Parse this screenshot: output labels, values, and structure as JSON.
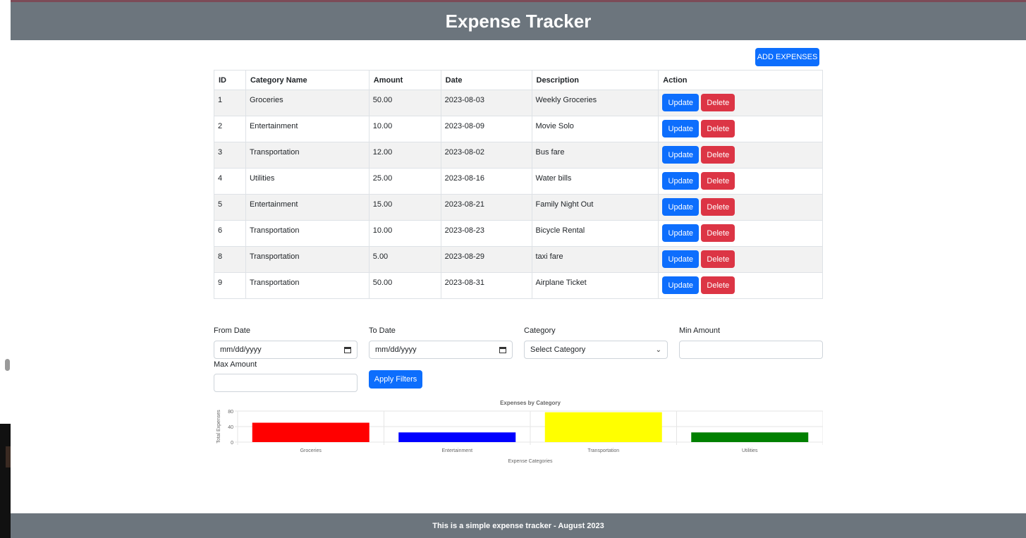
{
  "header": {
    "title": "Expense Tracker"
  },
  "toolbar": {
    "add_label": "ADD EXPENSES"
  },
  "table": {
    "columns": [
      "ID",
      "Category Name",
      "Amount",
      "Date",
      "Description",
      "Action"
    ],
    "rows": [
      {
        "id": "1",
        "category": "Groceries",
        "amount": "50.00",
        "date": "2023-08-03",
        "description": "Weekly Groceries"
      },
      {
        "id": "2",
        "category": "Entertainment",
        "amount": "10.00",
        "date": "2023-08-09",
        "description": "Movie Solo"
      },
      {
        "id": "3",
        "category": "Transportation",
        "amount": "12.00",
        "date": "2023-08-02",
        "description": "Bus fare"
      },
      {
        "id": "4",
        "category": "Utilities",
        "amount": "25.00",
        "date": "2023-08-16",
        "description": "Water bills"
      },
      {
        "id": "5",
        "category": "Entertainment",
        "amount": "15.00",
        "date": "2023-08-21",
        "description": "Family Night Out"
      },
      {
        "id": "6",
        "category": "Transportation",
        "amount": "10.00",
        "date": "2023-08-23",
        "description": "Bicycle Rental"
      },
      {
        "id": "8",
        "category": "Transportation",
        "amount": "5.00",
        "date": "2023-08-29",
        "description": "taxi fare"
      },
      {
        "id": "9",
        "category": "Transportation",
        "amount": "50.00",
        "date": "2023-08-31",
        "description": "Airplane Ticket"
      }
    ],
    "update_label": "Update",
    "delete_label": "Delete"
  },
  "filters": {
    "from_label": "From Date",
    "from_value": "mm/dd/yyyy",
    "to_label": "To Date",
    "to_value": "mm/dd/yyyy",
    "category_label": "Category",
    "category_value": "Select Category",
    "min_label": "Min Amount",
    "min_value": "",
    "max_label": "Max Amount",
    "max_value": "",
    "apply_label": "Apply Filters"
  },
  "chart_data": {
    "type": "bar",
    "title": "Expenses by Category",
    "xlabel": "Expense Categories",
    "ylabel": "Total Expenses",
    "categories": [
      "Groceries",
      "Entertainment",
      "Transportation",
      "Utilities"
    ],
    "values": [
      50,
      25,
      77,
      25
    ],
    "colors": [
      "#ff0000",
      "#0000ff",
      "#ffff00",
      "#008000"
    ],
    "yticks": [
      0,
      40,
      80
    ],
    "ylim": [
      0,
      80
    ],
    "grid": true,
    "legend": false
  },
  "footer": {
    "text": "This is a simple expense tracker - August 2023"
  },
  "colors": {
    "header_bg": "#6c757d",
    "primary": "#0d6efd",
    "danger": "#dc3545",
    "row_stripe": "#f2f2f2"
  }
}
